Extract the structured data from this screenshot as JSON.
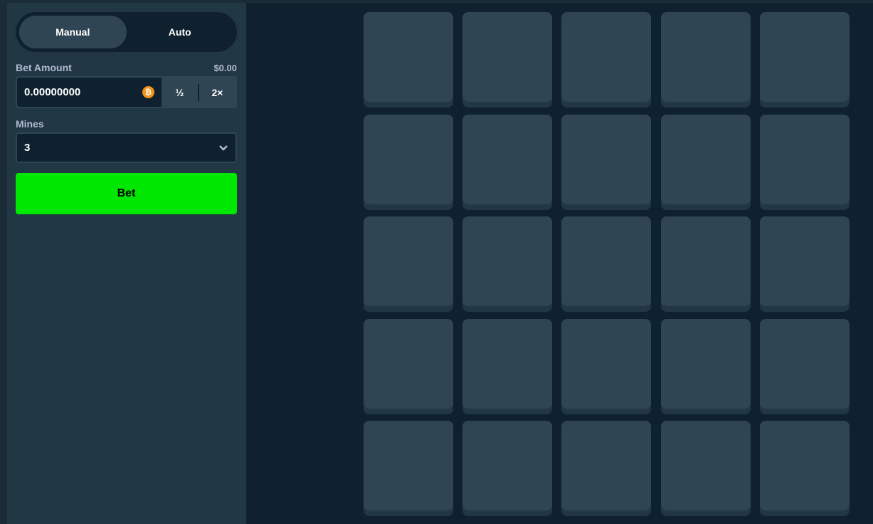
{
  "mode_tabs": {
    "manual": "Manual",
    "auto": "Auto",
    "active": "Manual"
  },
  "bet_amount": {
    "label": "Bet Amount",
    "usd_value": "$0.00",
    "value": "0.00000000",
    "currency_icon": "bitcoin-icon",
    "half_label": "½",
    "double_label": "2×"
  },
  "mines": {
    "label": "Mines",
    "selected": "3"
  },
  "bet_button": "Bet",
  "grid": {
    "rows": 5,
    "cols": 5
  },
  "colors": {
    "bet_button": "#00e701",
    "tile": "#2f4553",
    "background": "#0f212e",
    "sidebar": "#213743"
  }
}
